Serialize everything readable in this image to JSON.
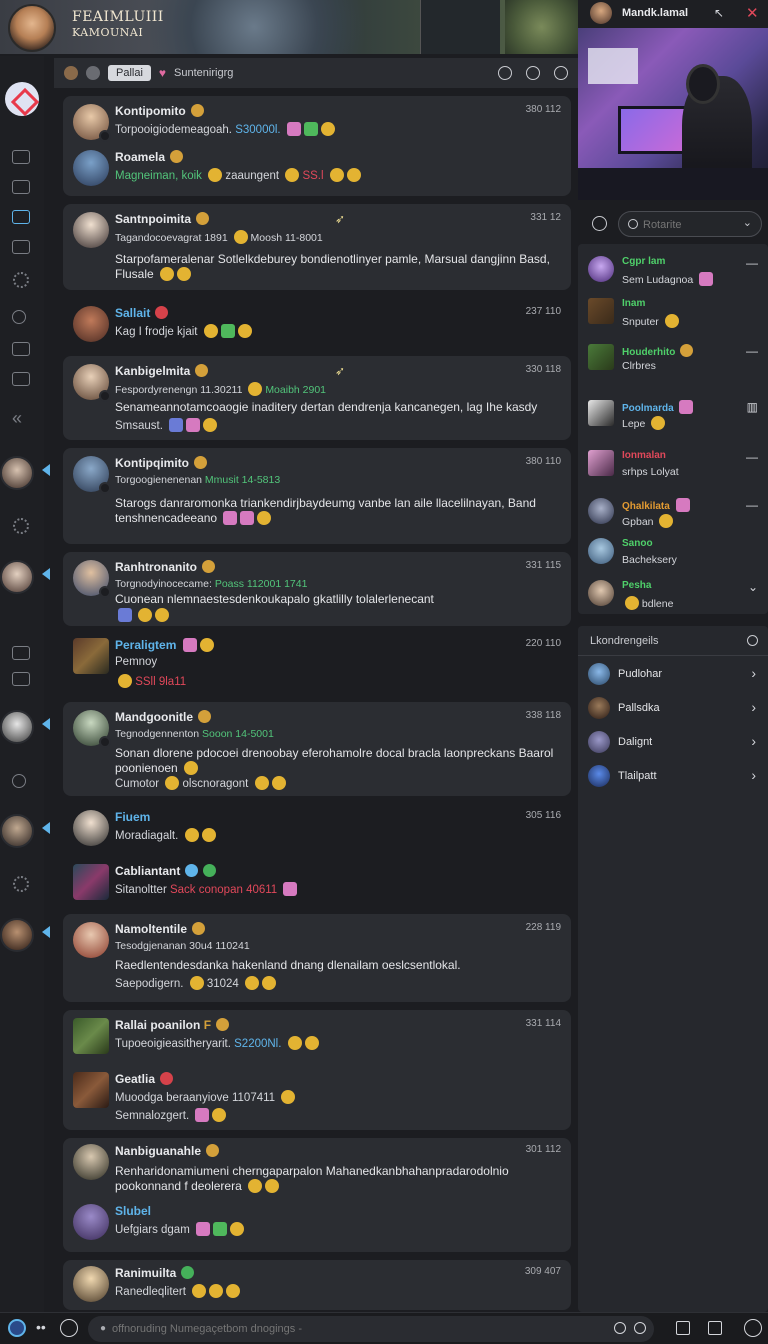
{
  "header": {
    "title_line1": "FEAIMLUIII",
    "title_line2": "KAMOUNAI"
  },
  "channel_bar": {
    "chip": "Pallai",
    "heart_icon": "heart-icon",
    "subtitle": "Suntenirigrg"
  },
  "top_right": {
    "user_name": "Mandk.lamal",
    "close_label": "✕",
    "pop_label": "↖"
  },
  "search": {
    "placeholder": "Rotarite"
  },
  "messages": [
    {
      "name": "Kontipomito",
      "time": "380 112",
      "line": "Torpooigiodemeagoah.",
      "highlight": "S30000l.",
      "color": "blue"
    },
    {
      "name": "Roamela",
      "time": "",
      "line": "Magneiman, koik",
      "line2": "zaaungent",
      "highlight": "SS.l",
      "color": "red"
    },
    {
      "name": "Santnpoimita",
      "time": "331 12",
      "line": "Tagandocoevagrat 1891",
      "line2": "Moosh 11-8001",
      "body": "Starpofameralenar Sotlelkdeburey bondienotlinyer pamle, Marsual dangjinn Basd, Flusale"
    },
    {
      "name": "Sallait",
      "time": "237 110",
      "line": "Kag I frodje kjait"
    },
    {
      "name": "Kanbigelmita",
      "time": "330 118",
      "line": "Fespordyrenengn 11.30211",
      "line2": "Moaibh 2901",
      "body": "Senameannotamcoaogie inaditery dertan dendrenja kancanegen, lag Ihe kasdy",
      "tail": "Smsaust."
    },
    {
      "name": "Kontipqimito",
      "time": "380 110",
      "line": "Torgoogienenenan",
      "line2": "Mmusit 14-5813",
      "body": "Starogs danraromonka triankendirjbaydeumg vanbe lan aile llacelilnayan, Band tenshnencadeeano"
    },
    {
      "name": "Ranhtronanito",
      "time": "331 115",
      "line": "Torgnodyinocecame:",
      "line2": "Poass 112001 1741",
      "body": "Cuonean nlemnaestesdenkoukapalo gkatlilly tolalerlenecant"
    },
    {
      "name": "Peraligtem",
      "time": "220 110",
      "line": "Pemnoy",
      "line2": "SSll 9la11",
      "color": "blue"
    },
    {
      "name": "Mandgoonitle",
      "time": "338 118",
      "line": "Tegnodgennenton",
      "line2": "Sooon 14-5001",
      "body": "Sonan dlorene pdocoei drenoobay eferohamolre docal bracla laonpreckans Baarol poonienoen",
      "tail": "Cumotor",
      "tail2": "olscnoragont"
    },
    {
      "name": "Fiuem",
      "time": "305 116",
      "line": "Moradiagalt.",
      "color": "blue"
    },
    {
      "name": "Cabliantant",
      "time": "",
      "line": "Sitanoltter",
      "highlight": "Sack conopan 40611",
      "color": "red"
    },
    {
      "name": "Namoltentile",
      "time": "228 119",
      "line": "Tesodgjenanan",
      "line2": "30u4 110241",
      "body": "Raedlentendesdanka hakenland dnang dlenailam oeslcsentlokal.",
      "tail": "Saepodigern.",
      "tail2": "31024"
    },
    {
      "name": "Rallai poanilon",
      "time": "331 114",
      "line": "Tupoeoigieasitheryarit.",
      "highlight": "S2200Nl."
    },
    {
      "name": "Geatlia",
      "time": "",
      "line": "Muoodga beraanyiove 1107411",
      "line2": "Semnalozgert."
    },
    {
      "name": "Nanbiguanahle",
      "time": "301 112",
      "body": "Renharidonamiumeni cherngaparpalon Mahanedkanbhahanpradarodolnio pookonnand f deolerera"
    },
    {
      "name": "Slubel",
      "time": "",
      "line": "Uefgiars dgam",
      "color": "blue"
    },
    {
      "name": "Ranimuilta",
      "time": "309 407",
      "line": "Ranedleqlitert"
    }
  ],
  "users": [
    {
      "name": "Cgpr lam",
      "sub": "Sem Ludagnoa",
      "color": "#4fd06a",
      "action": "—"
    },
    {
      "name": "Inam",
      "sub": "Snputer",
      "color": "#4fd06a",
      "action": ""
    },
    {
      "name": "Houderhito",
      "sub": "Clrbres",
      "color": "#4fd06a",
      "action": "—"
    },
    {
      "name": "Poolmarda",
      "sub": "Lepe",
      "color": "#5fb4ea",
      "action": "▥"
    },
    {
      "name": "Ionmalan",
      "sub": "srhps Lolyat",
      "color": "#e0485a",
      "action": "—"
    },
    {
      "name": "Qhalkilata",
      "sub": "Gpban",
      "color": "#e39b32",
      "action": "—"
    },
    {
      "name": "Sanoo",
      "sub": "Bacheksery",
      "color": "#4fd06a",
      "action": ""
    },
    {
      "name": "Pesha",
      "sub": "bdlene",
      "color": "#4fd06a",
      "action": "⌄"
    }
  ],
  "categories": {
    "title": "Lkondrengeils",
    "items": [
      {
        "label": "Pudlohar"
      },
      {
        "label": "Pallsdka"
      },
      {
        "label": "Dalignt"
      },
      {
        "label": "Tlailpatt"
      }
    ]
  },
  "composer": {
    "placeholder": "offnoruding Numegaçetbom dnogings -"
  }
}
